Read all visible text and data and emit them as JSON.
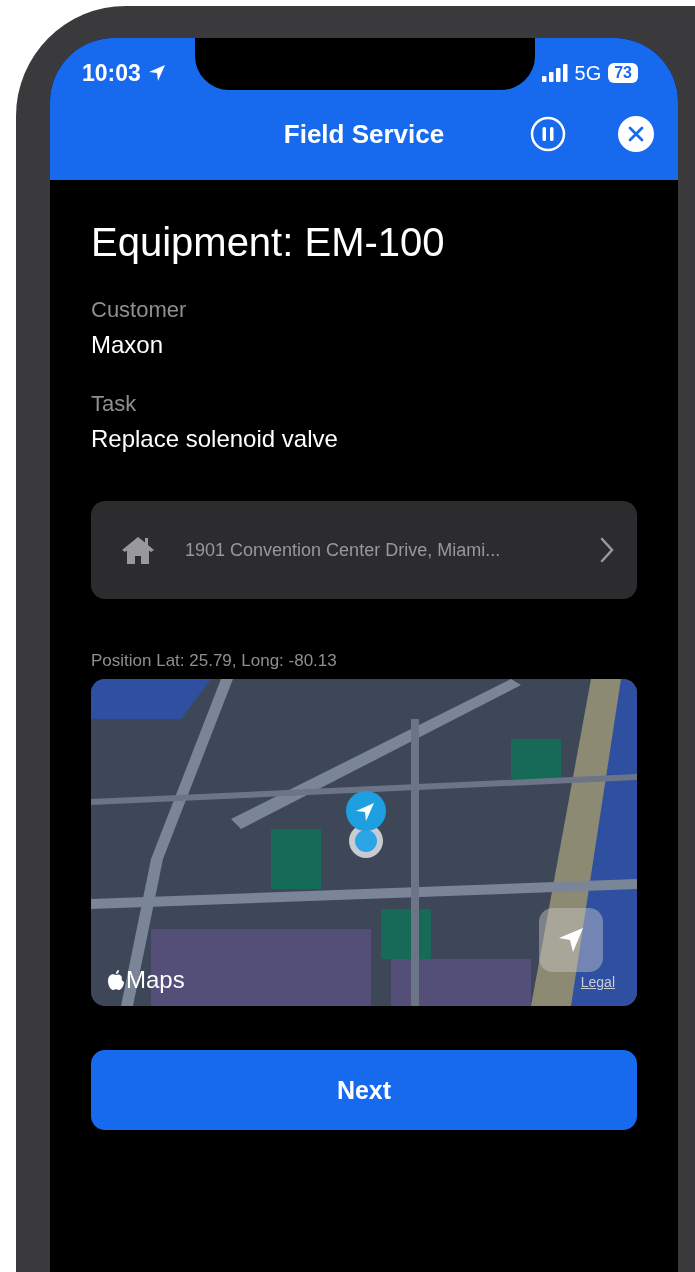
{
  "status_bar": {
    "time": "10:03",
    "network": "5G",
    "battery": "73"
  },
  "header": {
    "title": "Field Service"
  },
  "equipment_title": "Equipment: EM-100",
  "fields": [
    {
      "label": "Customer",
      "value": "Maxon"
    },
    {
      "label": "Task",
      "value": "Replace solenoid valve"
    }
  ],
  "address": {
    "text": "1901 Convention Center Drive, Miami..."
  },
  "position": "Position Lat: 25.79, Long: -80.13",
  "map": {
    "attribution": "Maps",
    "legal": "Legal"
  },
  "next_button": "Next"
}
